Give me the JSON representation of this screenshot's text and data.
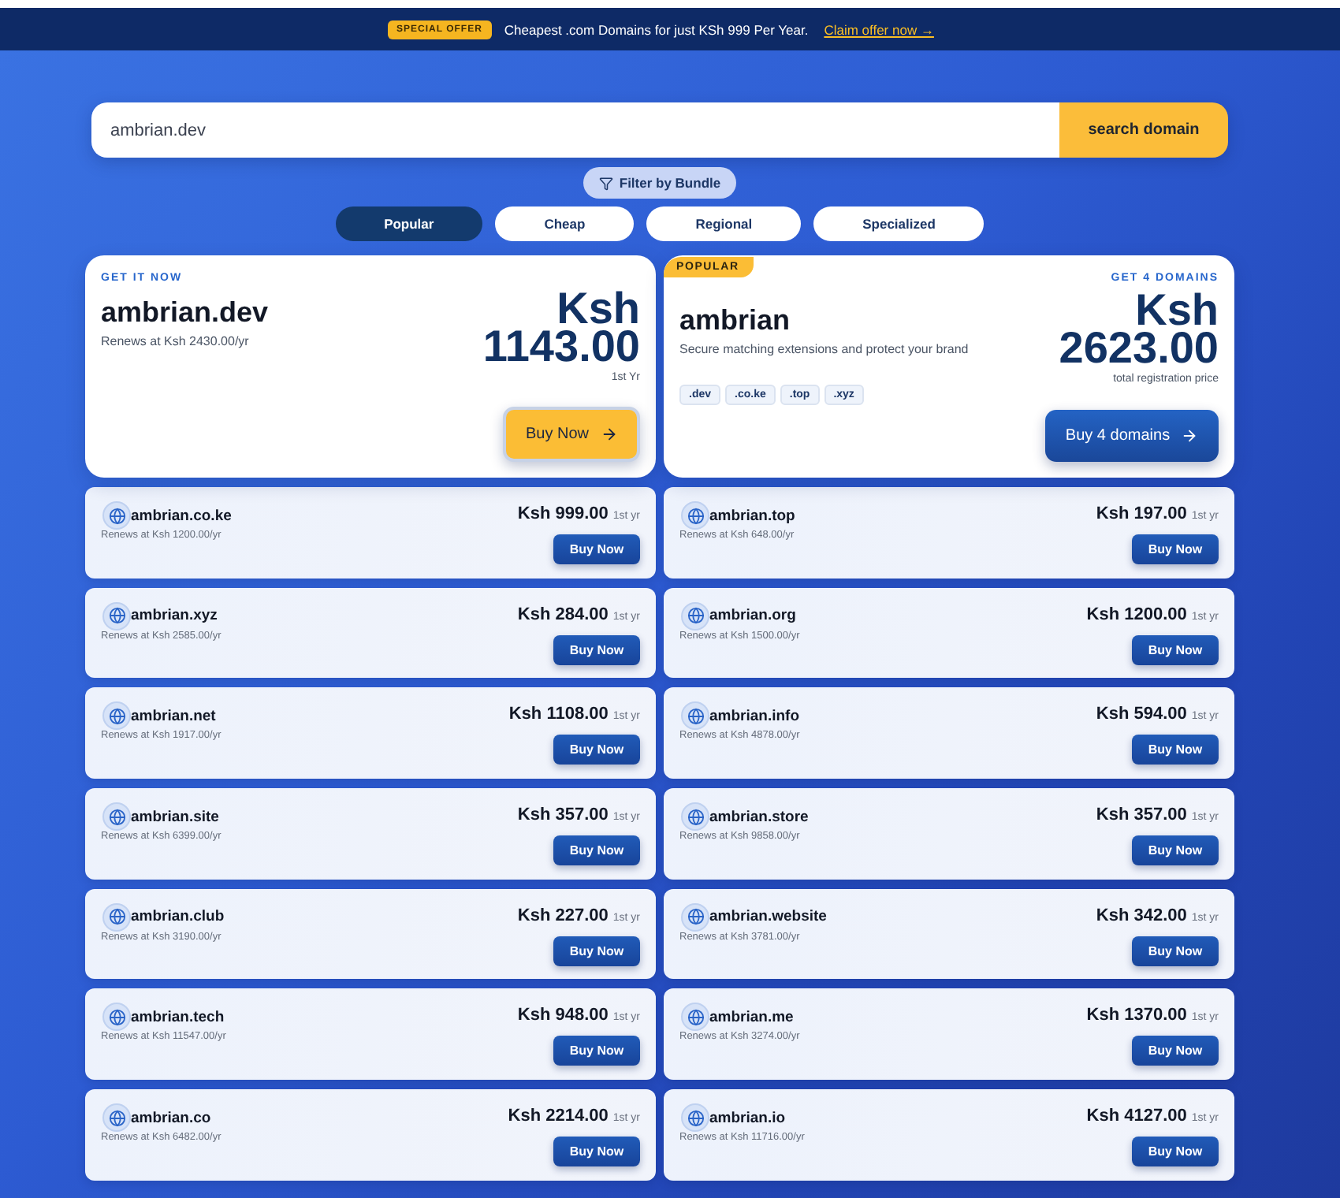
{
  "promo_banner": {
    "badge": "SPECIAL OFFER",
    "message": "Cheapest .com Domains for just KSh 999 Per Year.",
    "link": "Claim offer now →"
  },
  "search": {
    "value": "ambrian.dev",
    "button": "search domain"
  },
  "filter_button": {
    "label": "Filter by Bundle"
  },
  "tabs": [
    {
      "label": "Popular",
      "selected": true
    },
    {
      "label": "Cheap",
      "selected": false
    },
    {
      "label": "Regional",
      "selected": false
    },
    {
      "label": "Specialized",
      "selected": false
    }
  ],
  "featured": {
    "eyebrow": "GET IT NOW",
    "domain": "ambrian.dev",
    "renewal": "Renews at Ksh 2430.00/yr",
    "currency": "Ksh",
    "price": "1143.00",
    "term": "1st Yr",
    "button": "Buy Now"
  },
  "bundle": {
    "badge": "POPULAR",
    "eyebrow": "GET 4 DOMAINS",
    "name": "ambrian",
    "description": "Secure matching extensions and protect your brand",
    "extensions": [
      ".dev",
      ".co.ke",
      ".top",
      ".xyz"
    ],
    "currency": "Ksh",
    "price": "2623.00",
    "price_note": "total registration price",
    "button": "Buy 4 domains"
  },
  "domains": [
    {
      "name": "ambrian.co.ke",
      "renewal": "Renews at Ksh 1200.00/yr",
      "price": "Ksh 999.00",
      "term": "1st yr",
      "button": "Buy Now"
    },
    {
      "name": "ambrian.top",
      "renewal": "Renews at Ksh 648.00/yr",
      "price": "Ksh 197.00",
      "term": "1st yr",
      "button": "Buy Now"
    },
    {
      "name": "ambrian.xyz",
      "renewal": "Renews at Ksh 2585.00/yr",
      "price": "Ksh 284.00",
      "term": "1st yr",
      "button": "Buy Now"
    },
    {
      "name": "ambrian.org",
      "renewal": "Renews at Ksh 1500.00/yr",
      "price": "Ksh 1200.00",
      "term": "1st yr",
      "button": "Buy Now"
    },
    {
      "name": "ambrian.net",
      "renewal": "Renews at Ksh 1917.00/yr",
      "price": "Ksh 1108.00",
      "term": "1st yr",
      "button": "Buy Now"
    },
    {
      "name": "ambrian.info",
      "renewal": "Renews at Ksh 4878.00/yr",
      "price": "Ksh 594.00",
      "term": "1st yr",
      "button": "Buy Now"
    },
    {
      "name": "ambrian.site",
      "renewal": "Renews at Ksh 6399.00/yr",
      "price": "Ksh 357.00",
      "term": "1st yr",
      "button": "Buy Now"
    },
    {
      "name": "ambrian.store",
      "renewal": "Renews at Ksh 9858.00/yr",
      "price": "Ksh 357.00",
      "term": "1st yr",
      "button": "Buy Now"
    },
    {
      "name": "ambrian.club",
      "renewal": "Renews at Ksh 3190.00/yr",
      "price": "Ksh 227.00",
      "term": "1st yr",
      "button": "Buy Now"
    },
    {
      "name": "ambrian.website",
      "renewal": "Renews at Ksh 3781.00/yr",
      "price": "Ksh 342.00",
      "term": "1st yr",
      "button": "Buy Now"
    },
    {
      "name": "ambrian.tech",
      "renewal": "Renews at Ksh 11547.00/yr",
      "price": "Ksh 948.00",
      "term": "1st yr",
      "button": "Buy Now"
    },
    {
      "name": "ambrian.me",
      "renewal": "Renews at Ksh 3274.00/yr",
      "price": "Ksh 1370.00",
      "term": "1st yr",
      "button": "Buy Now"
    },
    {
      "name": "ambrian.co",
      "renewal": "Renews at Ksh 6482.00/yr",
      "price": "Ksh 2214.00",
      "term": "1st yr",
      "button": "Buy Now"
    },
    {
      "name": "ambrian.io",
      "renewal": "Renews at Ksh 11716.00/yr",
      "price": "Ksh 4127.00",
      "term": "1st yr",
      "button": "Buy Now"
    }
  ]
}
